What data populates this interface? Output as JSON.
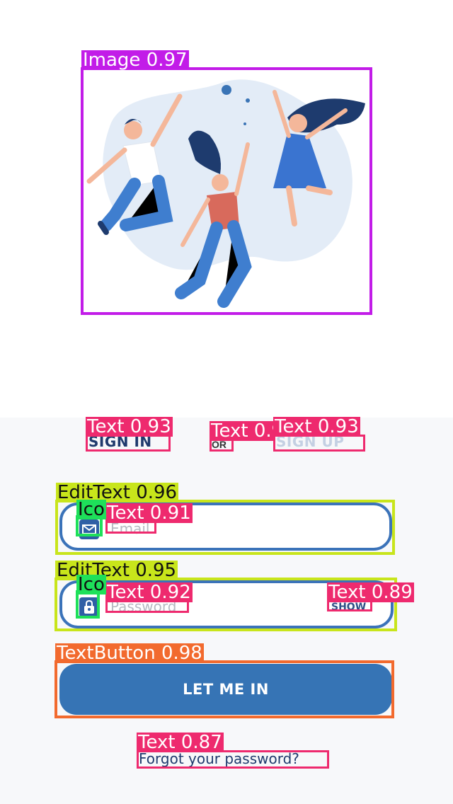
{
  "tabs": {
    "sign_in": "SIGN IN",
    "or": "OR",
    "sign_up": "SIGN UP"
  },
  "email": {
    "placeholder": "Email",
    "icon": "mail-icon"
  },
  "password": {
    "placeholder": "Password",
    "show": "SHOW",
    "icon": "lock-icon"
  },
  "cta": {
    "label": "LET ME IN"
  },
  "forgot": {
    "label": "Forgot your password?"
  },
  "illustration": {
    "icon": "people-jumping-illustration"
  },
  "colors": {
    "primary": "#3674b5",
    "primary_dark": "#1f3a6d",
    "field_border": "#3b73b9",
    "inactive_tab": "#c4d0e3",
    "image_box": "#c21ce8",
    "text_box": "#ee2a6e",
    "edittext_box": "#c8e51b",
    "icon_box": "#1ee05a",
    "button_box": "#f26a2e"
  },
  "detections": [
    {
      "label": "Image 0.97"
    },
    {
      "label": "Text 0.93"
    },
    {
      "label": "Text 0.93"
    },
    {
      "label": "Text 0.93"
    },
    {
      "label": "EditText 0.96"
    },
    {
      "label": "Text 0.91"
    },
    {
      "label": "Ico"
    },
    {
      "label": "EditText 0.95"
    },
    {
      "label": "Text 0.92"
    },
    {
      "label": "Ico"
    },
    {
      "label": "Text 0.89"
    },
    {
      "label": "TextButton 0.98"
    },
    {
      "label": "Text 0.87"
    }
  ]
}
